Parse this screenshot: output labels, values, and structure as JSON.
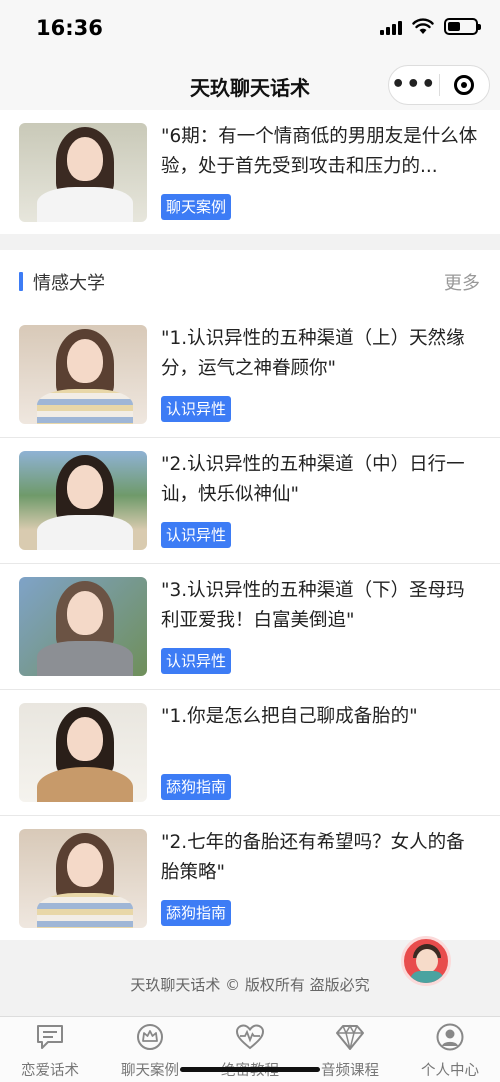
{
  "status_bar": {
    "time": "16:36"
  },
  "nav": {
    "title": "天玖聊天话术"
  },
  "top_item": {
    "title": "\"6期：有一个情商低的男朋友是什么体验，处于首先受到攻击和压力的...",
    "tag": "聊天案例"
  },
  "section": {
    "title": "情感大学",
    "more": "更多",
    "items": [
      {
        "title": "\"1.认识异性的五种渠道（上）天然缘分，运气之神眷顾你\"",
        "tag": "认识异性"
      },
      {
        "title": "\"2.认识异性的五种渠道（中）日行一讪，快乐似神仙\"",
        "tag": "认识异性"
      },
      {
        "title": "\"3.认识异性的五种渠道（下）圣母玛利亚爱我！白富美倒追\"",
        "tag": "认识异性"
      },
      {
        "title": "\"1.你是怎么把自己聊成备胎的\"",
        "tag": "舔狗指南"
      },
      {
        "title": "\"2.七年的备胎还有希望吗？女人的备胎策略\"",
        "tag": "舔狗指南"
      }
    ]
  },
  "footer": {
    "copyright": "天玖聊天话术 © 版权所有 盗版必究"
  },
  "tabs": [
    {
      "label": "恋爱话术",
      "icon": "chat-icon"
    },
    {
      "label": "聊天案例",
      "icon": "crown-icon"
    },
    {
      "label": "绝密教程",
      "icon": "heart-pulse-icon"
    },
    {
      "label": "音频课程",
      "icon": "diamond-icon"
    },
    {
      "label": "个人中心",
      "icon": "user-icon"
    }
  ],
  "colors": {
    "accent": "#3d7cf5",
    "background": "#f2f2f2"
  }
}
